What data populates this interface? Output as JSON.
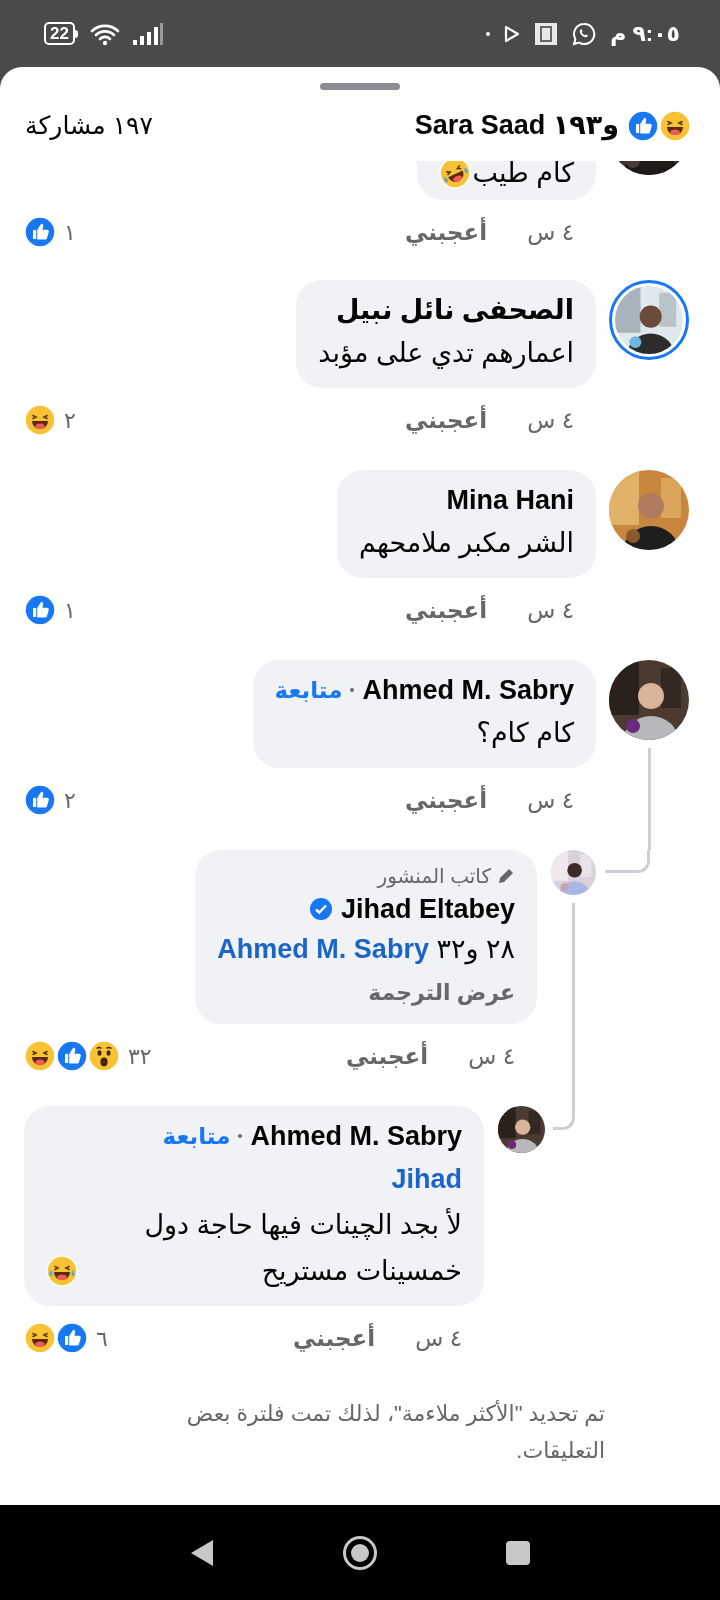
{
  "status_bar": {
    "time": "٩:٠٥ م",
    "battery": "22"
  },
  "header": {
    "reactions_text": "و١٩٣ Sara Saad",
    "reactions": [
      {
        "kind": "like"
      },
      {
        "kind": "haha"
      }
    ],
    "shares": "١٩٧ مشاركة"
  },
  "comments": [
    {
      "cut_off": true,
      "body": [
        [
          {
            "kind": "text",
            "text": "كام طيب"
          },
          {
            "kind": "rofl"
          }
        ]
      ],
      "time": "٤ س",
      "like_label": "أعجبني",
      "reactions": [
        {
          "kind": "like"
        }
      ],
      "reaction_count": "١"
    },
    {
      "cut_off": false,
      "story_ring": true,
      "name": "الصحفى نائل نبيل",
      "body": [
        [
          {
            "kind": "text",
            "text": "اعمارهم تدي على مؤبد"
          }
        ]
      ],
      "time": "٤ س",
      "like_label": "أعجبني",
      "reactions": [
        {
          "kind": "haha"
        }
      ],
      "reaction_count": "٢"
    },
    {
      "cut_off": false,
      "story_ring": false,
      "name": "Mina Hani",
      "body": [
        [
          {
            "kind": "text",
            "text": "الشر مكبر ملامحهم"
          }
        ]
      ],
      "time": "٤ س",
      "like_label": "أعجبني",
      "reactions": [
        {
          "kind": "like"
        }
      ],
      "reaction_count": "١"
    },
    {
      "cut_off": false,
      "story_ring": false,
      "name": "Ahmed M. Sabry",
      "follow": "متابعة",
      "body": [
        [
          {
            "kind": "text",
            "text": "كام كام؟"
          }
        ]
      ],
      "time": "٤ س",
      "like_label": "أعجبني",
      "reactions": [
        {
          "kind": "like"
        }
      ],
      "reaction_count": "٢",
      "children": [
        {
          "cut_off": false,
          "story_ring": false,
          "author_badge": "كاتب المنشور",
          "name": "Jihad Eltabey",
          "verified": true,
          "body": [
            [
              {
                "kind": "text",
                "text": "٢٨ و٣٢"
              },
              {
                "kind": "mention",
                "text": "Ahmed M. Sabry"
              }
            ]
          ],
          "see_translation": "عرض الترجمة",
          "time": "٤ س",
          "like_label": "أعجبني",
          "reactions": [
            {
              "kind": "haha"
            },
            {
              "kind": "like"
            },
            {
              "kind": "wow"
            }
          ],
          "reaction_count": "٣٢",
          "children": [
            {
              "cut_off": false,
              "story_ring": false,
              "name": "Ahmed M. Sabry",
              "follow": "متابعة",
              "body": [
                [
                  {
                    "kind": "mention",
                    "text": "Jihad"
                  }
                ],
                [
                  {
                    "kind": "text",
                    "text": "لأ بجد الچينات فيها حاجة دول خمسينات مستريح"
                  },
                  {
                    "kind": "tears_of_joy"
                  }
                ]
              ],
              "time": "٤ س",
              "like_label": "أعجبني",
              "reactions": [
                {
                  "kind": "haha"
                },
                {
                  "kind": "like"
                }
              ],
              "reaction_count": "٦"
            }
          ]
        }
      ]
    }
  ],
  "filter_notice": "تم تحديد \"الأكثر ملاءمة\"، لذلك تمت فلترة بعض التعليقات."
}
